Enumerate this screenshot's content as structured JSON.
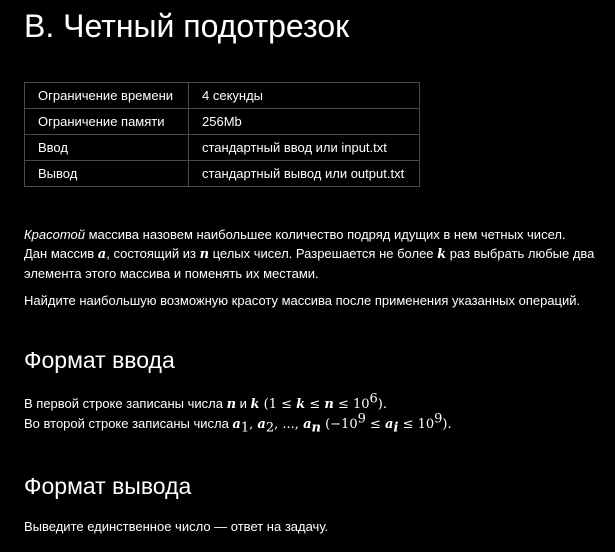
{
  "problem": {
    "title": "B. Четный подотрезок"
  },
  "limits": [
    {
      "label": "Ограничение времени",
      "value": "4 секунды"
    },
    {
      "label": "Ограничение памяти",
      "value": "256Mb"
    },
    {
      "label": "Ввод",
      "value": "стандартный ввод или input.txt"
    },
    {
      "label": "Вывод",
      "value": "стандартный вывод или output.txt"
    }
  ],
  "statement": {
    "term": "Красотой",
    "line1_rest": " массива назовем наибольшее количество подряд идущих в нем четных чисел.",
    "line2_a": "Дан массив ",
    "var_a": "a",
    "line2_b": ", состоящий из ",
    "var_n": "n",
    "line2_c": " целых чисел. Разрешается не более ",
    "var_k": "k",
    "line2_d": " раз выбрать любые два",
    "line3": "элемента этого массива и поменять их местами.",
    "task": "Найдите наибольшую возможную красоту массива после применения указанных операций."
  },
  "input_format": {
    "heading": "Формат ввода",
    "line1_a": "В первой строке записаны числа ",
    "line1_n": "n",
    "line1_and": " и ",
    "line1_k": "k",
    "line1_constraint_open": " (1 ≤ ",
    "line1_constraint_k": "k",
    "line1_constraint_le": " ≤ ",
    "line1_constraint_n": "n",
    "line1_constraint_le2": " ≤ 10",
    "line1_constraint_exp": "6",
    "line1_close": ").",
    "line2_a": "Во второй строке записаны числа ",
    "line2_a1": "a",
    "line2_sub1": "1",
    "line2_sep1": ", ",
    "line2_a2": "a",
    "line2_sub2": "2",
    "line2_dots": ", ..., ",
    "line2_an": "a",
    "line2_subn": "n",
    "line2_constraint_open": " (−10",
    "line2_constraint_exp1": "9",
    "line2_constraint_le": " ≤ ",
    "line2_constraint_ai": "a",
    "line2_constraint_subi": "i",
    "line2_constraint_le2": " ≤ 10",
    "line2_constraint_exp2": "9",
    "line2_close": ")."
  },
  "output_format": {
    "heading": "Формат вывода",
    "text": "Выведите единственное число — ответ на задачу."
  }
}
